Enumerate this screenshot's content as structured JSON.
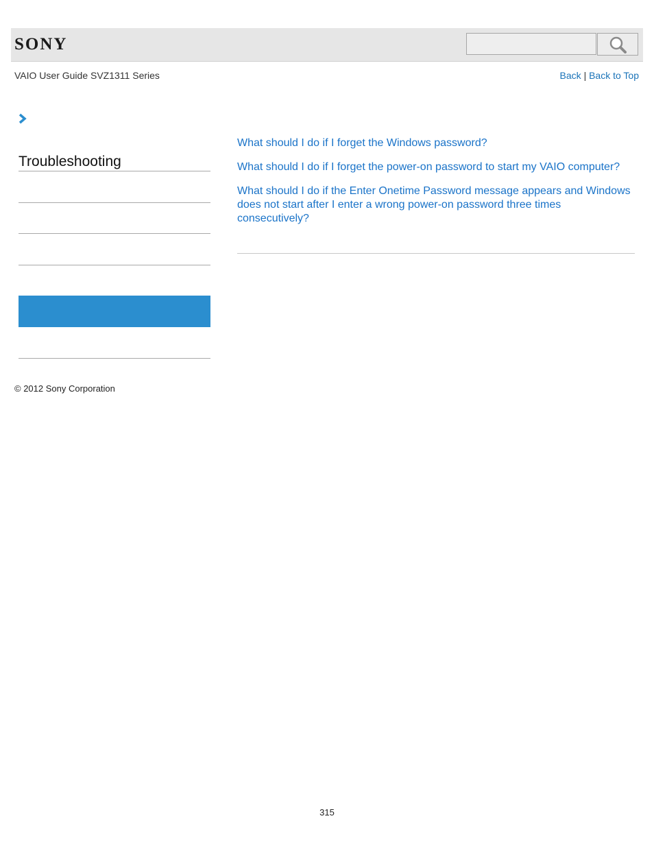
{
  "header": {
    "logo": "SONY",
    "search": {
      "placeholder": ""
    }
  },
  "guide_title": "VAIO User Guide SVZ1311 Series",
  "nav": {
    "back": "Back",
    "separator": "|",
    "back_to_top": "Back to Top"
  },
  "breadcrumb": {
    "icon": "chevron-right-icon"
  },
  "sidebar": {
    "title": "Troubleshooting"
  },
  "links": [
    "What should I do if I forget the Windows password?",
    "What should I do if I forget the power-on password to start my VAIO computer?",
    "What should I do if the Enter Onetime Password message appears and Windows does not start after I enter a wrong power-on password three times consecutively?"
  ],
  "footer": {
    "copyright": "© 2012 Sony Corporation",
    "page_number": "315"
  },
  "colors": {
    "accent": "#2b8ecf",
    "link": "#1a73c8",
    "header_bg": "#e6e6e6"
  }
}
